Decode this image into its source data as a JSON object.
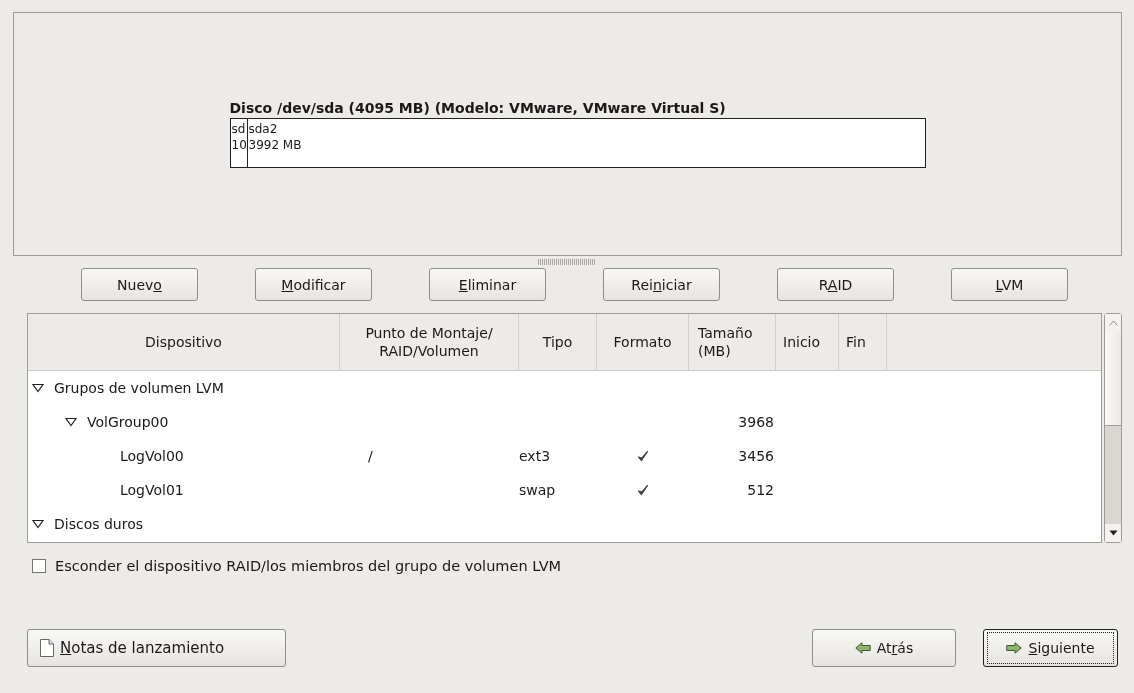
{
  "disk": {
    "title": "Disco /dev/sda (4095 MB) (Modelo: VMware, VMware Virtual S)",
    "partitions": [
      {
        "kind": "small",
        "name": "sd",
        "size": "10"
      },
      {
        "kind": "main",
        "name": "sda2",
        "size": "3992 MB"
      }
    ]
  },
  "actions": [
    {
      "label": {
        "before": "Nuev",
        "key": "o"
      }
    },
    {
      "label": {
        "key": "M",
        "after": "odificar"
      }
    },
    {
      "label": {
        "key": "E",
        "after": "liminar"
      }
    },
    {
      "label": {
        "before": "Rei",
        "key": "n",
        "after": "iciar"
      }
    },
    {
      "label": {
        "before": "R",
        "key": "A",
        "after": "ID"
      }
    },
    {
      "label": {
        "key": "L",
        "after": "VM"
      }
    }
  ],
  "table": {
    "columns": [
      "Dispositivo",
      "Punto de Montaje/\nRAID/Volumen",
      "Tipo",
      "Formato",
      "Tamaño\n(MB)",
      "Inicio",
      "Fin"
    ],
    "rows": [
      {
        "device": "Grupos de volumen LVM",
        "expanded": true,
        "children": [
          {
            "device": "VolGroup00",
            "expanded": true,
            "size": "3968",
            "children": [
              {
                "device": "LogVol00",
                "mount": "/",
                "type": "ext3",
                "format": true,
                "size": "3456"
              },
              {
                "device": "LogVol01",
                "type": "swap",
                "format": true,
                "size": "512"
              }
            ]
          }
        ]
      },
      {
        "device": "Discos duros",
        "expanded": true
      }
    ]
  },
  "hide_option": {
    "label": {
      "before": "Esconder el dispositivo RAID/los miembros del ",
      "key": "g",
      "after": "rupo de volumen LVM"
    },
    "checked": false
  },
  "footer": {
    "release_notes": {
      "label": {
        "key": "N",
        "after": "otas de lanzamiento"
      }
    },
    "back": {
      "label": {
        "before": "At",
        "key": "r",
        "after": "ás"
      }
    },
    "next": {
      "label": {
        "key": "S",
        "after": "iguiente"
      },
      "focused": true
    }
  }
}
